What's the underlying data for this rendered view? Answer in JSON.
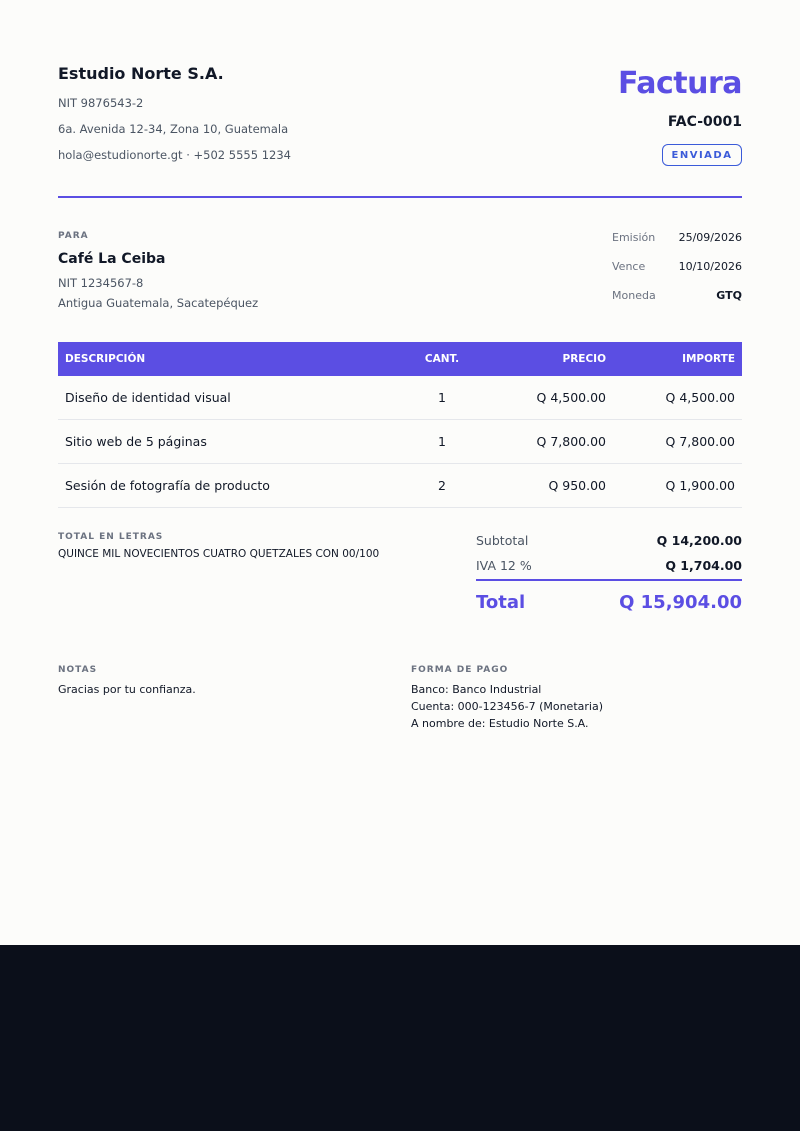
{
  "company": {
    "name": "Estudio Norte S.A.",
    "nit": "NIT 9876543-2",
    "address": "6a. Avenida 12-34, Zona 10, Guatemala",
    "contact": "hola@estudionorte.gt · +502 5555 1234"
  },
  "document": {
    "title": "Factura",
    "number": "FAC-0001",
    "status": "ENVIADA"
  },
  "client": {
    "section_label": "PARA",
    "name": "Café La Ceiba",
    "nit": "NIT 1234567-8",
    "address": "Antigua Guatemala, Sacatepéquez"
  },
  "meta": {
    "issue_label": "Emisión",
    "issue_value": "25/09/2026",
    "due_label": "Vence",
    "due_value": "10/10/2026",
    "currency_label": "Moneda",
    "currency_value": "GTQ"
  },
  "table": {
    "headers": {
      "description": "DESCRIPCIÓN",
      "quantity": "CANT.",
      "price": "PRECIO",
      "amount": "IMPORTE"
    },
    "rows": [
      {
        "description": "Diseño de identidad visual",
        "quantity": "1",
        "price": "Q 4,500.00",
        "amount": "Q 4,500.00"
      },
      {
        "description": "Sitio web de 5 páginas",
        "quantity": "1",
        "price": "Q 7,800.00",
        "amount": "Q 7,800.00"
      },
      {
        "description": "Sesión de fotografía de producto",
        "quantity": "2",
        "price": "Q 950.00",
        "amount": "Q 1,900.00"
      }
    ]
  },
  "amount_in_words": {
    "label": "TOTAL EN LETRAS",
    "value": "QUINCE MIL NOVECIENTOS CUATRO QUETZALES CON 00/100"
  },
  "summary": {
    "subtotal_label": "Subtotal",
    "subtotal_value": "Q 14,200.00",
    "tax_label": "IVA 12 %",
    "tax_value": "Q 1,704.00",
    "total_label": "Total",
    "total_value": "Q 15,904.00"
  },
  "notes": {
    "label": "NOTAS",
    "text": "Gracias por tu confianza."
  },
  "payment": {
    "label": "FORMA DE PAGO",
    "bank": "Banco: Banco Industrial",
    "account": "Cuenta: 000-123456-7 (Monetaria)",
    "holder": "A nombre de: Estudio Norte S.A."
  },
  "colors": {
    "accent": "#5b4ee3",
    "status": "#3b5bd9",
    "footer_background": "#0b0f1a"
  }
}
